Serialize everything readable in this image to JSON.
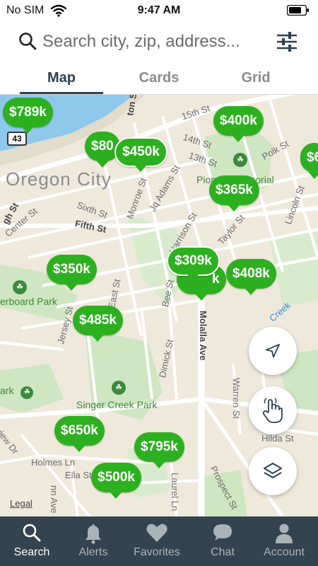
{
  "status_bar": {
    "carrier": "No SIM",
    "time": "9:47 AM"
  },
  "search": {
    "placeholder": "Search city, zip, address...",
    "value": ""
  },
  "view_tabs": [
    {
      "label": "Map",
      "active": true
    },
    {
      "label": "Cards",
      "active": false
    },
    {
      "label": "Grid",
      "active": false
    }
  ],
  "map": {
    "city_label": "Oregon City",
    "route_shield": "43",
    "legal": "Legal",
    "streets": {
      "s15th": "15th St",
      "s14th": "14th St",
      "s13th": "13th St",
      "polk": "Polk St",
      "taylor": "Taylor St",
      "lincoln": "Lincoln St",
      "monroe": "Monroe St",
      "jqadams": "Jq Adams St",
      "sixth": "Sixth St",
      "fifth": "Fifth St",
      "center": "Center St",
      "high": "gh St",
      "harrison": "Harrison St",
      "ton": "ton St",
      "bee": "Bee St",
      "east": "East St",
      "jersey": "Jersey St",
      "molalla": "Molalla Ave",
      "dimick": "Dimick St",
      "warren": "Warren St",
      "hilda": "Hilda St",
      "holmes": "Holmes Ln",
      "ella": "Ella St",
      "laurel": "Laurel Ln",
      "prospect": "Prospect St",
      "view": "view Dr",
      "nn": "nn Ave",
      "rvw": "rview Dr",
      "creek": "Creek"
    },
    "parks": {
      "singer": "Singer Creek Park",
      "rboard": "erboard Park",
      "ark": "ark",
      "pioneer": "Pioneer Memorial"
    },
    "price_pins": {
      "p789": "$789k",
      "p80": "$80",
      "p450": "$450k",
      "p400": "$400k",
      "p365": "$365k",
      "p6": "$6",
      "p350": "$350k",
      "p309": "$309k",
      "pk": "k",
      "p408": "$408k",
      "p485": "$485k",
      "p650": "$650k",
      "p795": "$795k",
      "p500": "$500k"
    }
  },
  "map_controls": [
    "location-arrow",
    "touch-gesture",
    "layers"
  ],
  "bottom_tabs": [
    {
      "label": "Search",
      "icon": "search-icon",
      "active": true
    },
    {
      "label": "Alerts",
      "icon": "bell-icon",
      "active": false
    },
    {
      "label": "Favorites",
      "icon": "heart-icon",
      "active": false
    },
    {
      "label": "Chat",
      "icon": "chat-bubble-icon",
      "active": false
    },
    {
      "label": "Account",
      "icon": "person-icon",
      "active": false
    }
  ],
  "colors": {
    "accent_green": "#2db01f",
    "tab_bar_bg": "#33434f",
    "river_blue": "#8ec8eb",
    "park_green": "#cfe6c2"
  }
}
